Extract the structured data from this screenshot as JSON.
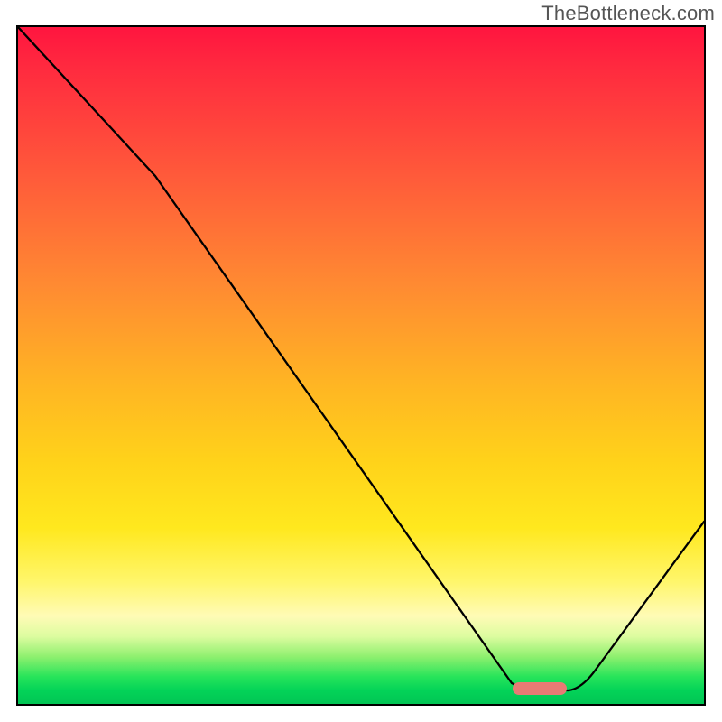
{
  "watermark": "TheBottleneck.com",
  "chart_data": {
    "type": "line",
    "title": "",
    "xlabel": "",
    "ylabel": "",
    "xlim": [
      0,
      100
    ],
    "ylim": [
      0,
      100
    ],
    "grid": false,
    "legend": false,
    "series": [
      {
        "name": "bottleneck-curve",
        "x": [
          0,
          20,
          72,
          80,
          100
        ],
        "y": [
          100,
          78,
          3,
          2,
          27
        ]
      }
    ],
    "marker": {
      "name": "optimal-range",
      "x_range": [
        72,
        80
      ],
      "y": 2
    },
    "background_gradient": {
      "top_color": "#ff153f",
      "mid_color": "#ffd21a",
      "bottom_color": "#02c554"
    }
  }
}
